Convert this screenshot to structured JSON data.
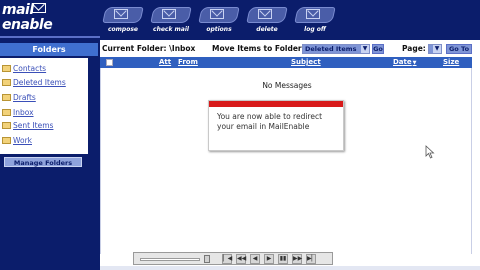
{
  "logo": {
    "line1": "mail",
    "line2": "enable"
  },
  "toolbar": {
    "buttons": [
      {
        "label": "compose",
        "icon": "compose-icon"
      },
      {
        "label": "check mail",
        "icon": "check-mail-icon"
      },
      {
        "label": "options",
        "icon": "options-icon"
      },
      {
        "label": "delete",
        "icon": "delete-icon"
      },
      {
        "label": "log off",
        "icon": "log-off-icon"
      }
    ]
  },
  "sidebar": {
    "heading": "Folders",
    "folders": [
      {
        "label": "Contacts"
      },
      {
        "label": "Deleted Items"
      },
      {
        "label": "Drafts"
      },
      {
        "label": "Inbox"
      },
      {
        "label": "Sent Items"
      },
      {
        "label": "Work"
      }
    ],
    "manage_label": "Manage Folders"
  },
  "main": {
    "current_folder_label": "Current Folder: \\Inbox",
    "move_label": "Move Items to Folder:",
    "move_target": "Deleted Items",
    "go_label": "Go",
    "page_label": "Page:",
    "page_value": "",
    "goto_label": "Go To",
    "columns": {
      "att": "Att",
      "from": "From",
      "subject": "Subject",
      "date": "Date",
      "size": "Size"
    },
    "date_sort_glyph": "▼",
    "empty_text": "No Messages"
  },
  "popup": {
    "text": "You are now able to redirect your email in MailEnable",
    "accent": "#d81a1a"
  },
  "player": {
    "buttons": [
      "▏◀",
      "◀◀",
      "◀",
      "▶",
      "▮▮",
      "▶▶",
      "▶▏"
    ]
  },
  "colors": {
    "navy": "#0b1d6b",
    "header_blue": "#2f5fbf",
    "link_blue": "#3a4fb8"
  }
}
